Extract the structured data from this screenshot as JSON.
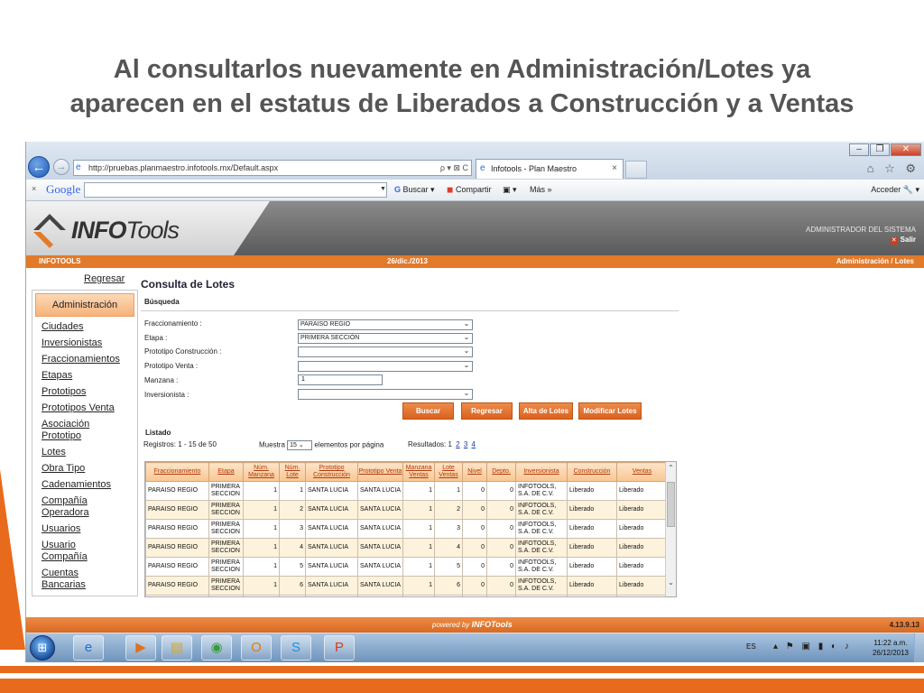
{
  "slide": {
    "title_line1": "Al consultarlos nuevamente en Administración/Lotes ya",
    "title_line2": "aparecen en el estatus de Liberados a Construcción y a Ventas",
    "accent_color": "#e86a1c"
  },
  "browser": {
    "url": "http://pruebas.planmaestro.infotools.mx/Default.aspx",
    "address_tools": "ρ ▾ ⊠ C",
    "tab_title": "Infotools - Plan Maestro",
    "tab_close": "×",
    "window_buttons": [
      "–",
      "❐",
      "✕"
    ],
    "right_icons": "⌂ ☆ ⚙",
    "google_toolbar": {
      "close": "×",
      "logo": "Google",
      "buscar": "Buscar",
      "compartir": "Compartir",
      "mas": "Más »",
      "acceder": "Acceder"
    }
  },
  "app": {
    "logo_bold": "INFO",
    "logo_light": "Tools",
    "user_role": "ADMINISTRADOR DEL SISTEMA",
    "logout": "Salir",
    "bar_left": "INFOTOOLS",
    "bar_date": "26/dic./2013",
    "bar_breadcrumb": "Administración / Lotes",
    "regresar_link": "Regresar",
    "sidebar": {
      "header": "Administración",
      "items": [
        "Ciudades",
        "Inversionistas",
        "Fraccionamientos",
        "Etapas",
        "Prototipos",
        "Prototipos Venta",
        "Asociación Prototipo",
        "Lotes",
        "Obra Tipo",
        "Cadenamientos",
        "Compañía Operadora",
        "Usuarios",
        "Usuario Compañía",
        "Cuentas Bancarias"
      ]
    },
    "page_title": "Consulta de Lotes",
    "busqueda_label": "Búsqueda",
    "form": {
      "fraccionamiento_label": "Fraccionamiento :",
      "fraccionamiento_value": "PARAISO REGIO",
      "etapa_label": "Etapa :",
      "etapa_value": "PRIMERA SECCIÓN",
      "proto_const_label": "Prototipo Construcción :",
      "proto_const_value": "",
      "proto_venta_label": "Prototipo Venta :",
      "proto_venta_value": "",
      "manzana_label": "Manzana :",
      "manzana_value": "1",
      "inversionista_label": "Inversionista :",
      "inversionista_value": ""
    },
    "buttons": {
      "buscar": "Buscar",
      "regresar": "Regresar",
      "alta": "Alta de Lotes",
      "modificar": "Modificar Lotes"
    },
    "listado_label": "Listado",
    "registros": "Registros: 1 - 15 de 50",
    "muestra_label": "Muestra",
    "muestra_value": "15",
    "muestra_suffix": "elementos por página",
    "resultados_label": "Resultados:",
    "pages": [
      "1",
      "2",
      "3",
      "4"
    ],
    "table": {
      "headers": [
        "Fraccionamiento",
        "Etapa",
        "Núm. Manzana",
        "Núm. Lote",
        "Prototipo Construcción",
        "Prototipo Venta",
        "Manzana Ventas",
        "Lote Ventas",
        "Nivel",
        "Depto.",
        "Inversionista",
        "Construcción",
        "Ventas"
      ],
      "rows": [
        [
          "PARAISO REGIO",
          "PRIMERA SECCION",
          "1",
          "1",
          "SANTA LUCIA",
          "SANTA LUCIA",
          "1",
          "1",
          "0",
          "0",
          "INFOTOOLS, S.A. DE C.V.",
          "Liberado",
          "Liberado"
        ],
        [
          "PARAISO REGIO",
          "PRIMERA SECCION",
          "1",
          "2",
          "SANTA LUCIA",
          "SANTA LUCIA",
          "1",
          "2",
          "0",
          "0",
          "INFOTOOLS, S.A. DE C.V.",
          "Liberado",
          "Liberado"
        ],
        [
          "PARAISO REGIO",
          "PRIMERA SECCION",
          "1",
          "3",
          "SANTA LUCIA",
          "SANTA LUCIA",
          "1",
          "3",
          "0",
          "0",
          "INFOTOOLS, S.A. DE C.V.",
          "Liberado",
          "Liberado"
        ],
        [
          "PARAISO REGIO",
          "PRIMERA SECCION",
          "1",
          "4",
          "SANTA LUCIA",
          "SANTA LUCIA",
          "1",
          "4",
          "0",
          "0",
          "INFOTOOLS, S.A. DE C.V.",
          "Liberado",
          "Liberado"
        ],
        [
          "PARAISO REGIO",
          "PRIMERA SECCION",
          "1",
          "5",
          "SANTA LUCIA",
          "SANTA LUCIA",
          "1",
          "5",
          "0",
          "0",
          "INFOTOOLS, S.A. DE C.V.",
          "Liberado",
          "Liberado"
        ],
        [
          "PARAISO REGIO",
          "PRIMERA SECCION",
          "1",
          "6",
          "SANTA LUCIA",
          "SANTA LUCIA",
          "1",
          "6",
          "0",
          "0",
          "INFOTOOLS, S.A. DE C.V.",
          "Liberado",
          "Liberado"
        ],
        [
          "",
          "PRIMERA",
          "",
          "",
          "",
          "SANTA",
          "",
          "",
          "",
          "",
          "INFOTOOLS,",
          "",
          ""
        ]
      ]
    },
    "powered_by": "powered by",
    "powered_brand": "INFOTools",
    "version": "4.13.9.13"
  },
  "taskbar": {
    "apps": [
      {
        "icon": "ie-icon",
        "glyph": "e"
      },
      {
        "icon": "media-player-icon",
        "glyph": "▶"
      },
      {
        "icon": "explorer-folder-icon",
        "glyph": "▤"
      },
      {
        "icon": "chrome-icon",
        "glyph": "◉"
      },
      {
        "icon": "outlook-icon",
        "glyph": "O"
      },
      {
        "icon": "skype-icon",
        "glyph": "S"
      },
      {
        "icon": "powerpoint-icon",
        "glyph": "P"
      }
    ],
    "language": "ES",
    "time": "11:22 a.m.",
    "date": "26/12/2013"
  }
}
